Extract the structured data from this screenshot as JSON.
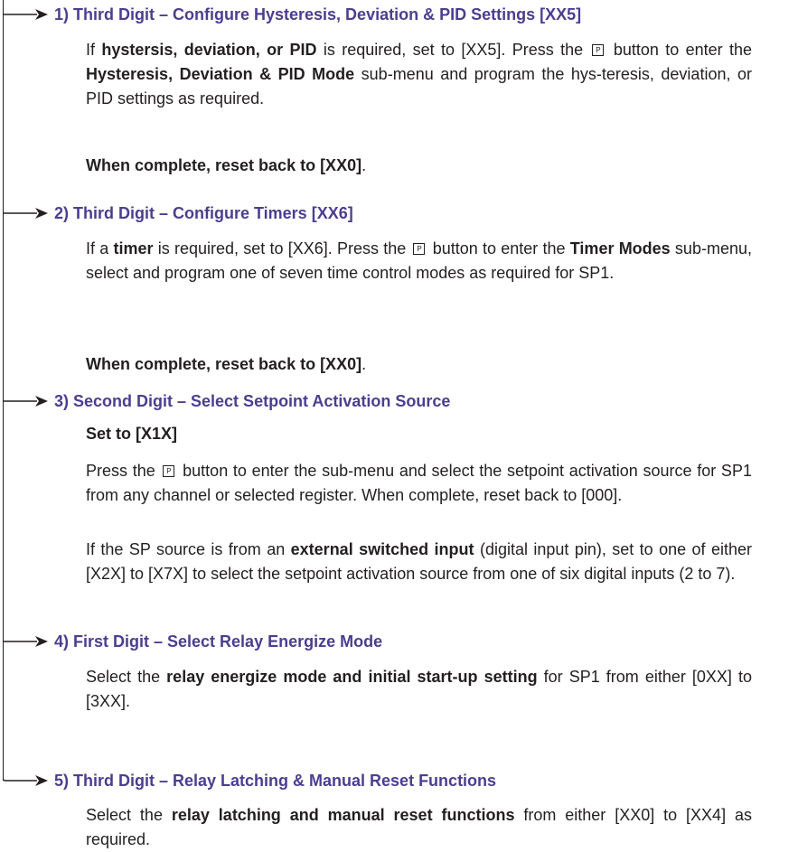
{
  "p_button_glyph": "P",
  "steps": [
    {
      "heading": "1) Third Digit – Configure Hysteresis, Deviation & PID Settings [XX5]",
      "para1": {
        "t1": "If ",
        "b1": "hystersis, deviation, or PID",
        "t2": " is required, set to [XX5]. Press the",
        "t3": "button to enter the ",
        "b2": "Hysteresis, Deviation & PID Mode",
        "t4": " sub-menu and program the hys-teresis, deviation, or PID settings as required."
      },
      "complete_bold": "When complete, reset back to [XX0]",
      "complete_end": "."
    },
    {
      "heading": "2) Third Digit – Configure Timers [XX6]",
      "para1": {
        "t1": "If a ",
        "b1": "timer",
        "t2": " is required, set to [XX6]. Press the",
        "t3": "button to enter the ",
        "b2": "Timer Modes",
        "t4": " sub-menu, select and program one of seven time control modes as required for SP1."
      },
      "complete_bold": "When complete, reset back to [XX0]",
      "complete_end": "."
    },
    {
      "heading": "3) Second Digit – Select Setpoint Activation Source",
      "subhead": "Set to [X1X]",
      "para1": {
        "t1": "Press the",
        "t2": "button to enter the sub-menu and select the setpoint activation source for SP1 from any channel or selected register. When complete, reset back to [000]."
      },
      "para2": {
        "t1": "If the SP source is from an ",
        "b1": "external switched input",
        "t2": " (digital input pin), set to one of either [X2X] to [X7X] to select the setpoint activation source from one of six digital inputs (2 to 7)."
      }
    },
    {
      "heading": "4) First Digit – Select Relay Energize Mode",
      "para1": {
        "t1": "Select the ",
        "b1": "relay energize mode and initial start-up setting",
        "t2": " for SP1 from either [0XX] to [3XX]."
      }
    },
    {
      "heading": "5) Third Digit – Relay Latching & Manual Reset Functions",
      "para1": {
        "t1": "Select the ",
        "b1": "relay latching and manual reset functions",
        "t2": " from either [XX0] to [XX4] as required."
      }
    }
  ]
}
